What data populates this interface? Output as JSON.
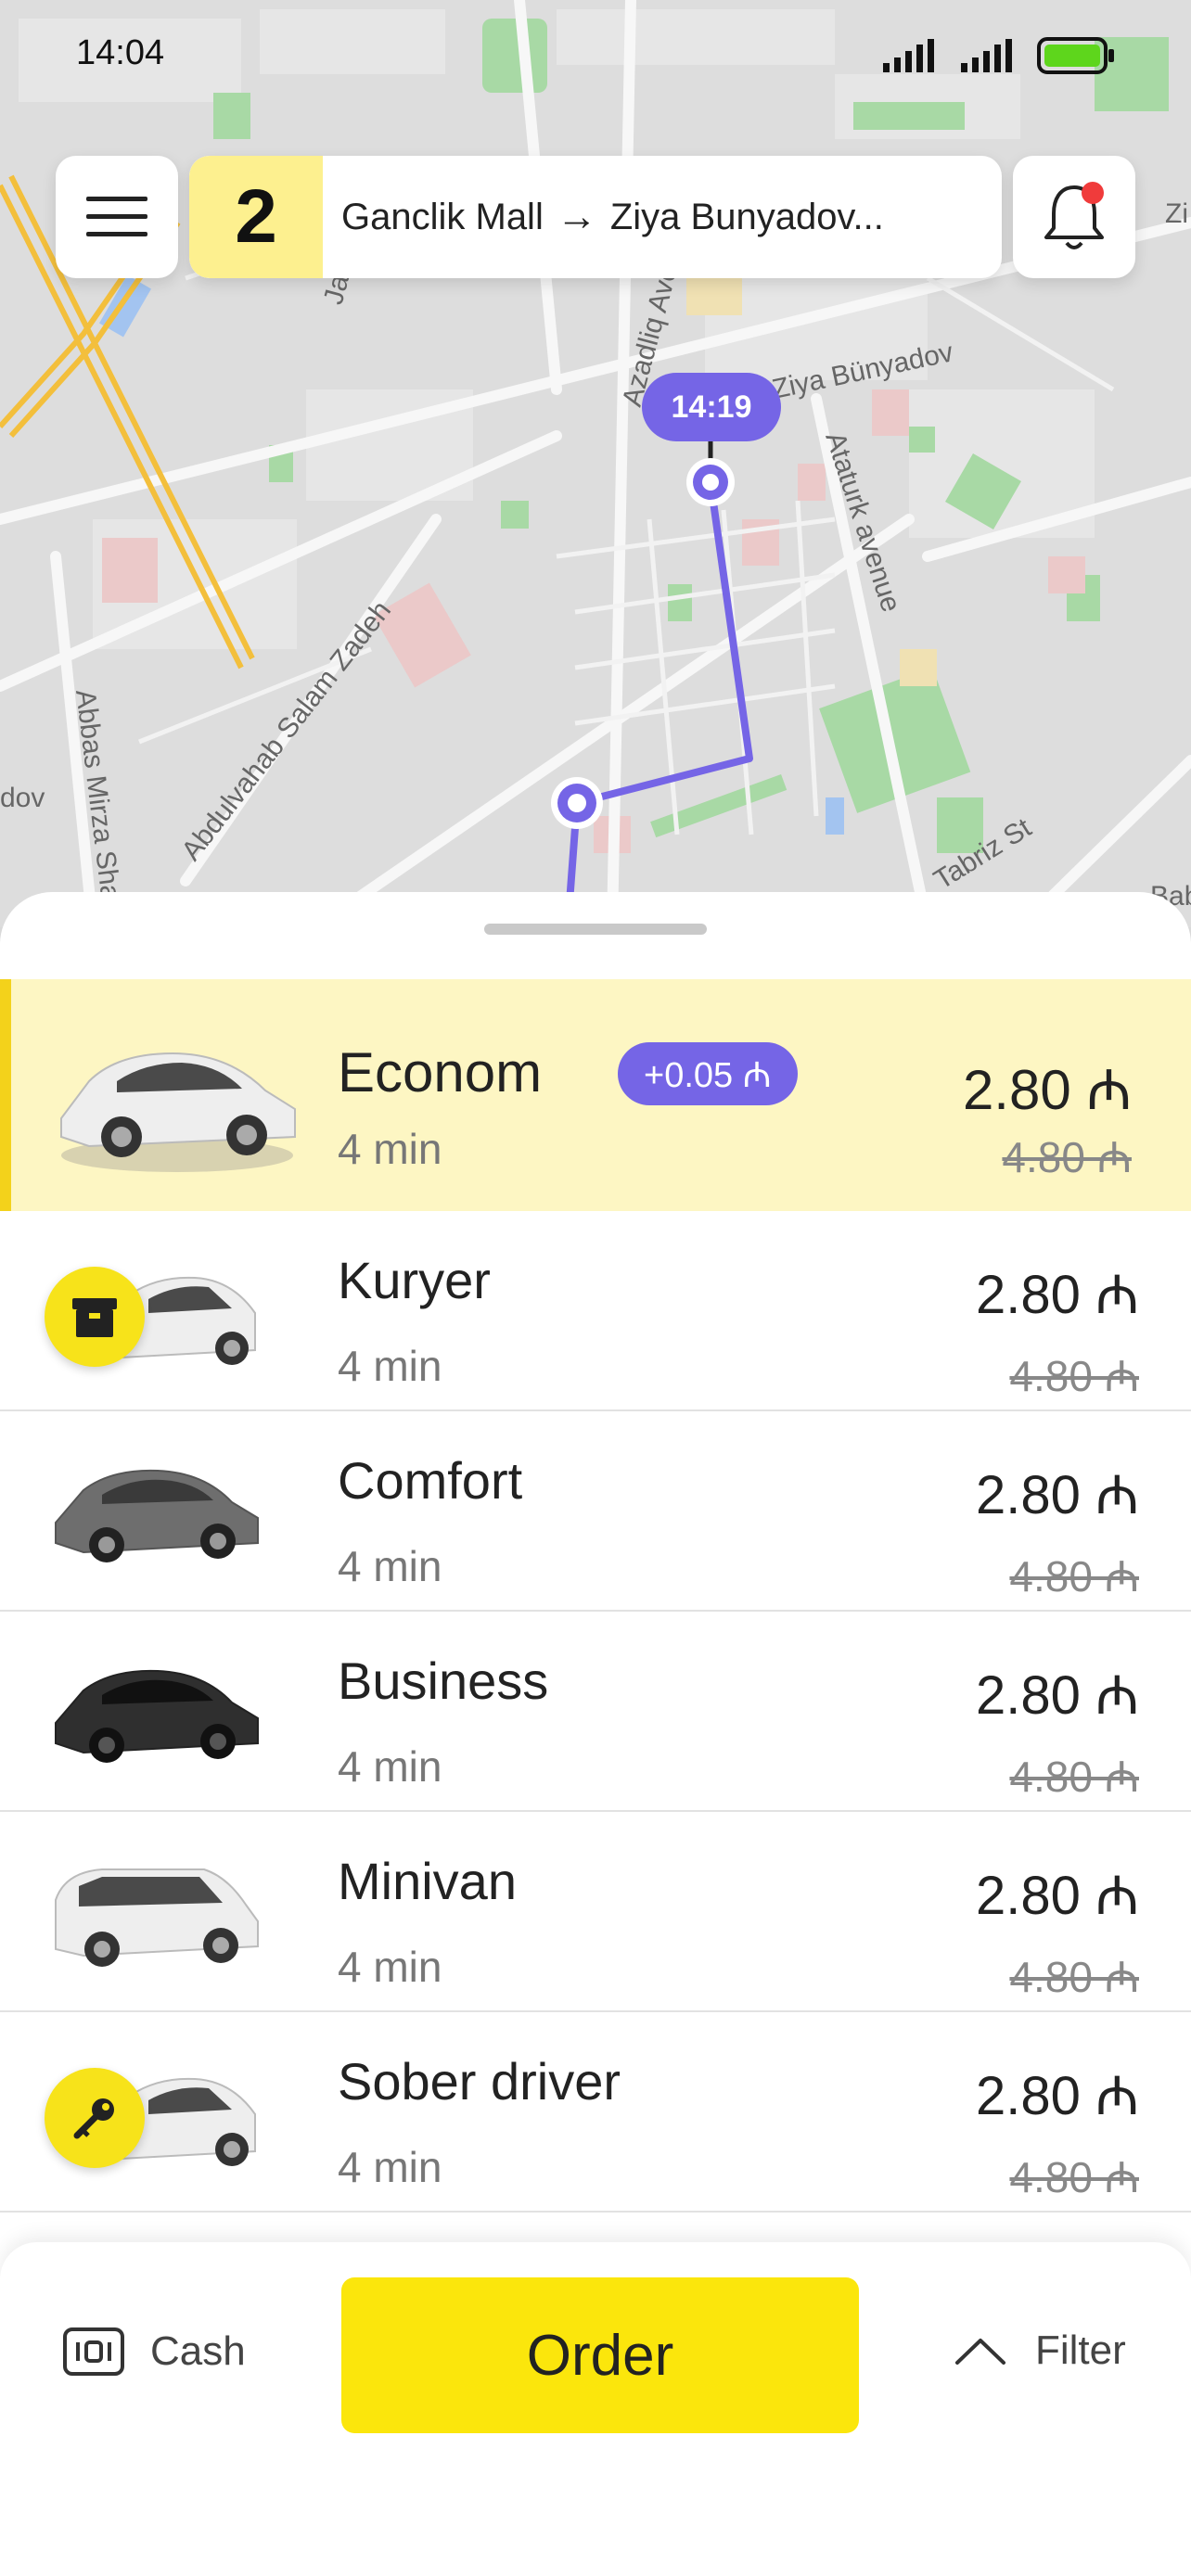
{
  "status_bar": {
    "time": "14:04"
  },
  "route": {
    "stops_count": "2",
    "from": "Ganclik Mall",
    "to": "Ziya Bunyadov..."
  },
  "map": {
    "eta": "14:19",
    "labels": [
      "Azadliq Ave",
      "Ziya Bünyadov",
      "Ataturk avenue",
      "Abdulvahab Salam Zadeh",
      "Abbas Mirza Sha",
      "Tabriz St",
      "dov",
      "Ja",
      "Zi",
      "Bab"
    ]
  },
  "tariffs": [
    {
      "name": "Econom",
      "eta": "4 min",
      "price": "2.80 ₼",
      "old_price": "4.80 ₼",
      "badge": "+0.05 ₼",
      "selected": true
    },
    {
      "name": "Kuryer",
      "eta": "4 min",
      "price": "2.80 ₼",
      "old_price": "4.80 ₼",
      "icon": "package-icon"
    },
    {
      "name": "Comfort",
      "eta": "4 min",
      "price": "2.80 ₼",
      "old_price": "4.80 ₼"
    },
    {
      "name": "Business",
      "eta": "4 min",
      "price": "2.80 ₼",
      "old_price": "4.80 ₼"
    },
    {
      "name": "Minivan",
      "eta": "4 min",
      "price": "2.80 ₼",
      "old_price": "4.80 ₼"
    },
    {
      "name": "Sober driver",
      "eta": "4 min",
      "price": "2.80 ₼",
      "old_price": "4.80 ₼",
      "icon": "key-icon"
    }
  ],
  "bottom_bar": {
    "payment": "Cash",
    "order": "Order",
    "filter": "Filter"
  },
  "colors": {
    "accent_yellow": "#fbe60c",
    "selected_row": "#fdf6c3",
    "route_purple": "#7565e6"
  }
}
